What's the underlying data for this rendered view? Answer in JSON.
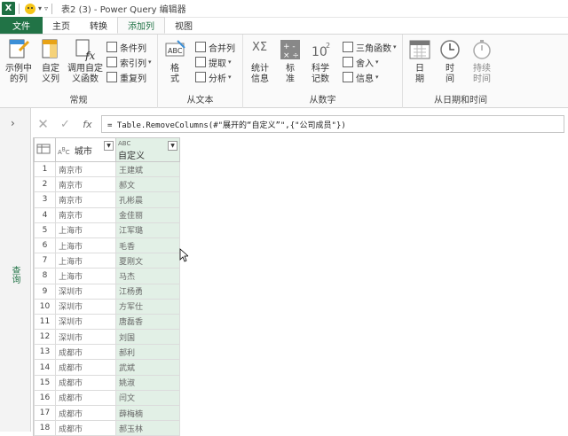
{
  "titlebar": {
    "app_icon": "X",
    "title": "表2 (3) - Power Query 编辑器"
  },
  "tabs": [
    {
      "label": "文件"
    },
    {
      "label": "主页"
    },
    {
      "label": "转换"
    },
    {
      "label": "添加列"
    },
    {
      "label": "视图"
    }
  ],
  "ribbon": {
    "general": {
      "label": "常规",
      "example_col": "示例中的列",
      "custom_col": "自定义列",
      "invoke_fn": "调用自定义函数",
      "conditional": "条件列",
      "index": "索引列",
      "duplicate": "重复列"
    },
    "text": {
      "label": "从文本",
      "format": "格式",
      "merge": "合并列",
      "extract": "提取",
      "parse": "分析"
    },
    "number": {
      "label": "从数字",
      "stats": "统计信息",
      "standard": "标准",
      "scientific": "科学记数",
      "trig": "三角函数",
      "round": "舍入",
      "info": "信息"
    },
    "datetime": {
      "label": "从日期和时间",
      "date": "日期",
      "time": "时间",
      "duration": "持续时间"
    }
  },
  "leftpane": {
    "label": "查询"
  },
  "formula": "= Table.RemoveColumns(#\"展开的“自定义”\",{\"公司成员\"})",
  "table": {
    "headers": {
      "col1": "城市",
      "col2": "自定义"
    },
    "rows": [
      {
        "n": "1",
        "city": "南京市",
        "name": "王建斌"
      },
      {
        "n": "2",
        "city": "南京市",
        "name": "郝文"
      },
      {
        "n": "3",
        "city": "南京市",
        "name": "孔彬晨"
      },
      {
        "n": "4",
        "city": "南京市",
        "name": "金佳丽"
      },
      {
        "n": "5",
        "city": "上海市",
        "name": "江军璐"
      },
      {
        "n": "6",
        "city": "上海市",
        "name": "毛香"
      },
      {
        "n": "7",
        "city": "上海市",
        "name": "夏刚文"
      },
      {
        "n": "8",
        "city": "上海市",
        "name": "马杰"
      },
      {
        "n": "9",
        "city": "深圳市",
        "name": "江杨勇"
      },
      {
        "n": "10",
        "city": "深圳市",
        "name": "方军仕"
      },
      {
        "n": "11",
        "city": "深圳市",
        "name": "唐磊香"
      },
      {
        "n": "12",
        "city": "深圳市",
        "name": "刘国"
      },
      {
        "n": "13",
        "city": "成都市",
        "name": "郝利"
      },
      {
        "n": "14",
        "city": "成都市",
        "name": "武斌"
      },
      {
        "n": "15",
        "city": "成都市",
        "name": "姚淑"
      },
      {
        "n": "16",
        "city": "成都市",
        "name": "闫文"
      },
      {
        "n": "17",
        "city": "成都市",
        "name": "薛梅楠"
      },
      {
        "n": "18",
        "city": "成都市",
        "name": "郝玉林"
      }
    ]
  }
}
